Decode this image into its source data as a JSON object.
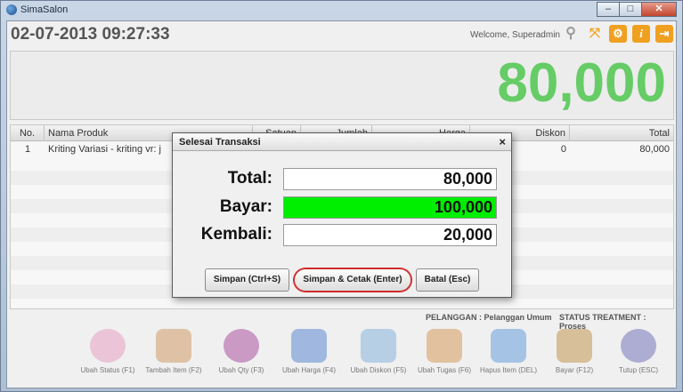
{
  "window": {
    "title": "SimaSalon",
    "min": "–",
    "max": "□",
    "close": "✕"
  },
  "header": {
    "datetime": "02-07-2013 09:27:33",
    "welcome": "Welcome,  Superadmin"
  },
  "total_display": "80,000",
  "table": {
    "columns": [
      "No.",
      "Nama Produk",
      "Satuan",
      "Jumlah",
      "Harga",
      "Diskon",
      "Total"
    ],
    "rows": [
      {
        "no": "1",
        "nama": "Kriting Variasi - kriting vr: j",
        "diskon": "0",
        "total": "80,000"
      }
    ]
  },
  "status": {
    "pelanggan": "PELANGGAN : Pelanggan Umum",
    "treatment": "STATUS TREATMENT : Proses"
  },
  "toolbar": [
    {
      "label": "Ubah Status (F1)",
      "icon": "flower-icon",
      "color": "#e58fb8"
    },
    {
      "label": "Tambah Item (F2)",
      "icon": "add-item-icon",
      "color": "#c98a4a"
    },
    {
      "label": "Ubah Qty (F3)",
      "icon": "comb-icon",
      "color": "#9b2f8f"
    },
    {
      "label": "Ubah Harga (F4)",
      "icon": "price-tag-icon",
      "color": "#3d74c9"
    },
    {
      "label": "Ubah Diskon (F5)",
      "icon": "discount-icon",
      "color": "#6ea6d8"
    },
    {
      "label": "Ubah Tugas (F6)",
      "icon": "scissors-icon",
      "color": "#d1883b"
    },
    {
      "label": "Hapus Item (DEL)",
      "icon": "delete-icon",
      "color": "#4a8fd6"
    },
    {
      "label": "Bayar (F12)",
      "icon": "wallet-icon",
      "color": "#b6832e"
    },
    {
      "label": "Tutup (ESC)",
      "icon": "exit-icon",
      "color": "#5a5ab0"
    }
  ],
  "dialog": {
    "title": "Selesai Transaksi",
    "close": "×",
    "total_label": "Total:",
    "total_value": "80,000",
    "bayar_label": "Bayar:",
    "bayar_value": "100,000",
    "kembali_label": "Kembali:",
    "kembali_value": "20,000",
    "btn_simpan": "Simpan (Ctrl+S)",
    "btn_cetak": "Simpan & Cetak (Enter)",
    "btn_batal": "Batal (Esc)"
  }
}
